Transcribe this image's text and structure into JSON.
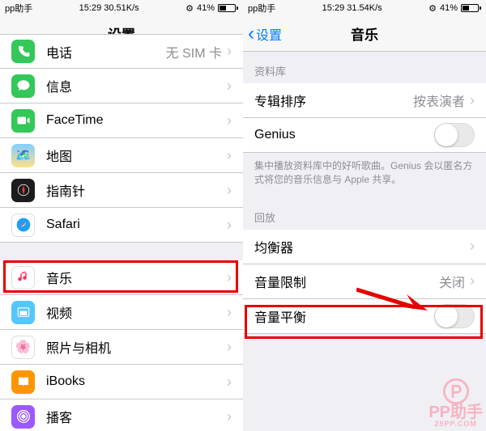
{
  "left": {
    "status": {
      "carrier": "pp助手",
      "time": "15:29",
      "speed": "30.51K/s",
      "batteryPct": "41%"
    },
    "nav": {
      "title": "设置"
    },
    "rows": [
      {
        "icon": "phone",
        "bg": "#34c759",
        "label": "电话",
        "value": "无 SIM 卡"
      },
      {
        "icon": "message",
        "bg": "#34c759",
        "label": "信息",
        "value": ""
      },
      {
        "icon": "facetime",
        "bg": "#34c759",
        "label": "FaceTime",
        "value": ""
      },
      {
        "icon": "maps",
        "bg": "#1ca0f2",
        "label": "地图",
        "value": ""
      },
      {
        "icon": "compass",
        "bg": "#1c1c1e",
        "label": "指南针",
        "value": ""
      },
      {
        "icon": "safari",
        "bg": "#ffffff",
        "label": "Safari",
        "value": ""
      }
    ],
    "rows2": [
      {
        "icon": "music",
        "bg": "#ffffff",
        "label": "音乐",
        "value": ""
      },
      {
        "icon": "video",
        "bg": "#54c7fc",
        "label": "视频",
        "value": ""
      },
      {
        "icon": "photos",
        "bg": "#ffffff",
        "label": "照片与相机",
        "value": ""
      },
      {
        "icon": "ibooks",
        "bg": "#ff9500",
        "label": "iBooks",
        "value": ""
      },
      {
        "icon": "podcast",
        "bg": "#9b59ff",
        "label": "播客",
        "value": ""
      }
    ]
  },
  "right": {
    "status": {
      "carrier": "pp助手",
      "time": "15:29",
      "speed": "31.54K/s",
      "batteryPct": "41%"
    },
    "nav": {
      "back": "设置",
      "title": "音乐"
    },
    "section1": {
      "header": "资料库"
    },
    "r1": {
      "label": "专辑排序",
      "value": "按表演者"
    },
    "r2": {
      "label": "Genius"
    },
    "footer1": "集中播放资料库中的好听歌曲。Genius 会以匿名方式将您的音乐信息与 Apple 共享。",
    "section2": {
      "header": "回放"
    },
    "r3": {
      "label": "均衡器"
    },
    "r4": {
      "label": "音量限制",
      "value": "关闭"
    },
    "r5": {
      "label": "音量平衡"
    }
  },
  "watermark": {
    "title": "PP助手",
    "url": "25PP.COM"
  }
}
